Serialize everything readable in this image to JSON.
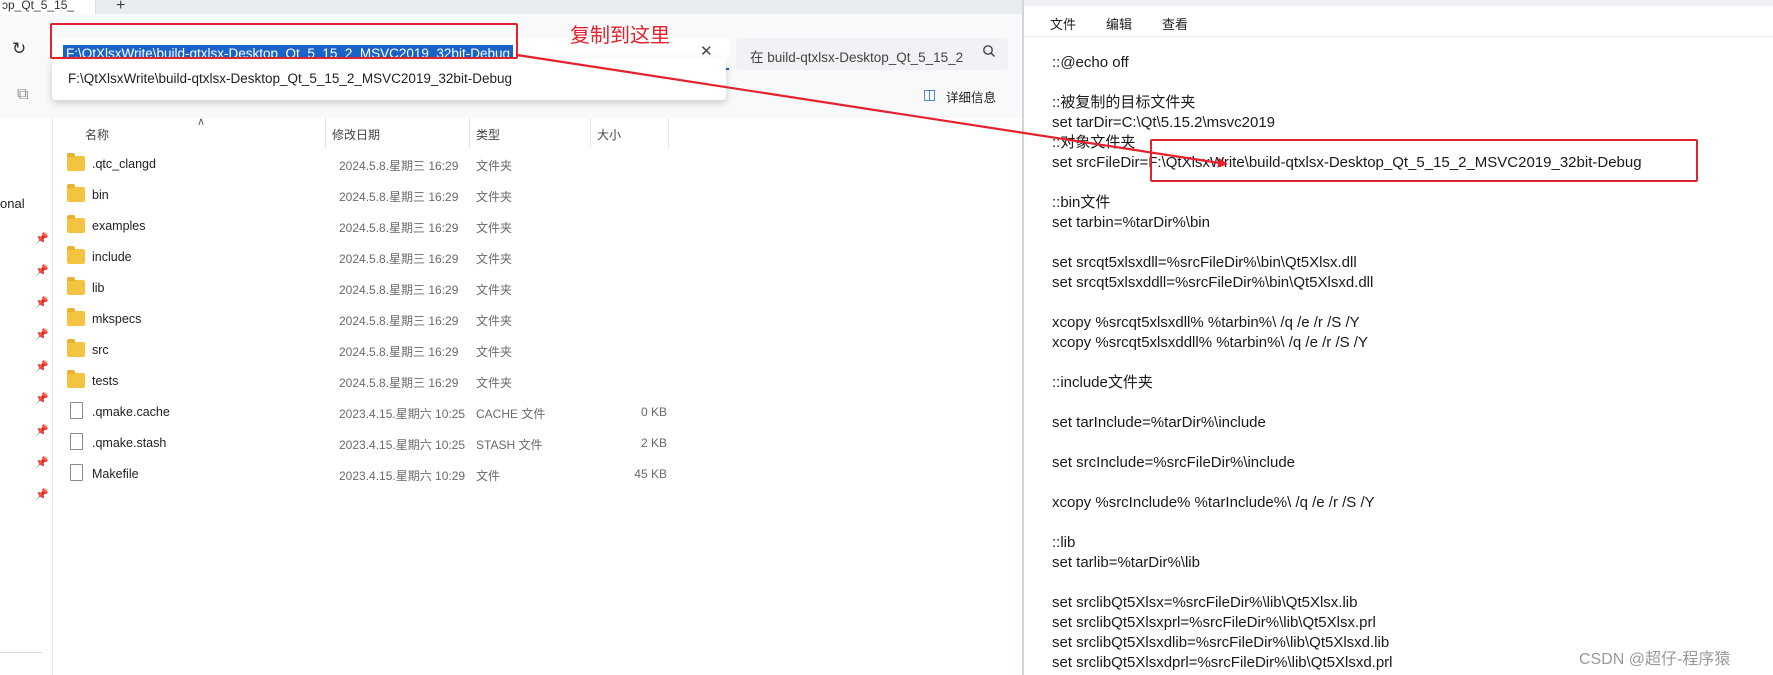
{
  "explorer": {
    "tab_label": "ɔp_Qt_5_15_",
    "tab_add_glyph": "+",
    "address_value": "F:\\QtXlsxWrite\\build-qtxlsx-Desktop_Qt_5_15_2_MSVC2019_32bit-Debug",
    "search_placeholder": "在 build-qtxlsx-Desktop_Qt_5_15_2",
    "suggestion_text": "F:\\QtXlsxWrite\\build-qtxlsx-Desktop_Qt_5_15_2_MSVC2019_32bit-Debug",
    "details_label": "详细信息",
    "nav_label": "onal",
    "columns": {
      "name": "名称",
      "modified": "修改日期",
      "type": "类型",
      "size": "大小"
    },
    "files": [
      {
        "name": ".qtc_clangd",
        "date": "2024.5.8.星期三 16:29",
        "type": "文件夹",
        "size": "",
        "kind": "folder"
      },
      {
        "name": "bin",
        "date": "2024.5.8.星期三 16:29",
        "type": "文件夹",
        "size": "",
        "kind": "folder"
      },
      {
        "name": "examples",
        "date": "2024.5.8.星期三 16:29",
        "type": "文件夹",
        "size": "",
        "kind": "folder"
      },
      {
        "name": "include",
        "date": "2024.5.8.星期三 16:29",
        "type": "文件夹",
        "size": "",
        "kind": "folder"
      },
      {
        "name": "lib",
        "date": "2024.5.8.星期三 16:29",
        "type": "文件夹",
        "size": "",
        "kind": "folder"
      },
      {
        "name": "mkspecs",
        "date": "2024.5.8.星期三 16:29",
        "type": "文件夹",
        "size": "",
        "kind": "folder"
      },
      {
        "name": "src",
        "date": "2024.5.8.星期三 16:29",
        "type": "文件夹",
        "size": "",
        "kind": "folder"
      },
      {
        "name": "tests",
        "date": "2024.5.8.星期三 16:29",
        "type": "文件夹",
        "size": "",
        "kind": "folder"
      },
      {
        "name": ".qmake.cache",
        "date": "2023.4.15.星期六 10:25",
        "type": "CACHE 文件",
        "size": "0 KB",
        "kind": "file"
      },
      {
        "name": ".qmake.stash",
        "date": "2023.4.15.星期六 10:25",
        "type": "STASH 文件",
        "size": "2 KB",
        "kind": "file"
      },
      {
        "name": "Makefile",
        "date": "2023.4.15.星期六 10:29",
        "type": "文件",
        "size": "45 KB",
        "kind": "file"
      }
    ]
  },
  "annotation": {
    "label": "复制到这里",
    "color": "#e3222d"
  },
  "notepad": {
    "menu": [
      "文件",
      "编辑",
      "查看"
    ],
    "lines": [
      "::@echo off",
      "",
      "::被复制的目标文件夹",
      "set tarDir=C:\\Qt\\5.15.2\\msvc2019",
      "::对象文件夹",
      "set srcFileDir=F:\\QtXlsxWrite\\build-qtxlsx-Desktop_Qt_5_15_2_MSVC2019_32bit-Debug",
      "",
      "::bin文件",
      "set tarbin=%tarDir%\\bin",
      "",
      "set srcqt5xlsxdll=%srcFileDir%\\bin\\Qt5Xlsx.dll",
      "set srcqt5xlsxddll=%srcFileDir%\\bin\\Qt5Xlsxd.dll",
      "",
      "xcopy %srcqt5xlsxdll% %tarbin%\\ /q /e /r /S /Y",
      "xcopy %srcqt5xlsxddll% %tarbin%\\ /q /e /r /S /Y",
      "",
      "::include文件夹",
      "",
      "set tarInclude=%tarDir%\\include",
      "",
      "set srcInclude=%srcFileDir%\\include",
      "",
      "xcopy %srcInclude% %tarInclude%\\ /q /e /r /S /Y",
      "",
      "::lib",
      "set tarlib=%tarDir%\\lib",
      "",
      "set srclibQt5Xlsx=%srcFileDir%\\lib\\Qt5Xlsx.lib",
      "set srclibQt5Xlsxprl=%srcFileDir%\\lib\\Qt5Xlsx.prl",
      "set srclibQt5Xlsxdlib=%srcFileDir%\\lib\\Qt5Xlsxd.lib",
      "set srclibQt5Xlsxdprl=%srcFileDir%\\lib\\Qt5Xlsxd.prl"
    ]
  },
  "watermark": "CSDN @超仔-程序猿",
  "icons": {
    "refresh": "refresh-icon",
    "clear": "close-icon",
    "search": "search-icon",
    "copy": "copy-icon",
    "details": "details-pane-icon",
    "pin": "pin-icon",
    "folder": "folder-icon",
    "file": "file-icon"
  }
}
